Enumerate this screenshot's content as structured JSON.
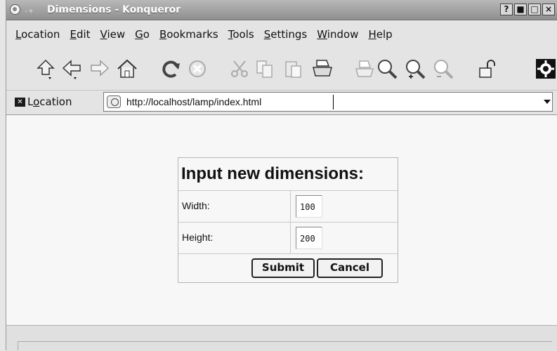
{
  "window": {
    "title": "Dimensions - Konqueror",
    "pin_glyph": "-+",
    "controls": [
      "?",
      "■",
      "□",
      "×"
    ]
  },
  "menubar": [
    {
      "mnemonic": "L",
      "rest": "ocation"
    },
    {
      "mnemonic": "E",
      "rest": "dit"
    },
    {
      "mnemonic": "V",
      "rest": "iew"
    },
    {
      "mnemonic": "G",
      "rest": "o"
    },
    {
      "mnemonic": "B",
      "rest": "ookmarks"
    },
    {
      "mnemonic": "T",
      "rest": "ools"
    },
    {
      "mnemonic": "S",
      "rest": "ettings"
    },
    {
      "mnemonic": "W",
      "rest": "indow"
    },
    {
      "mnemonic": "H",
      "rest": "elp"
    }
  ],
  "toolbar": [
    "up-icon",
    "back-icon",
    "forward-icon",
    "home-icon",
    "reload-icon",
    "stop-icon",
    "cut-icon",
    "copy-icon",
    "paste-icon",
    "print-icon",
    "print-frame-icon",
    "zoom-icon",
    "zoom-in-icon",
    "zoom-out-icon",
    "lock-icon",
    "throbber-icon"
  ],
  "location": {
    "label_mnemonic": "o",
    "label_before": "L",
    "label_after": "cation",
    "url": "http://localhost/lamp/index.html"
  },
  "form": {
    "title": "Input new dimensions:",
    "width_label": "Width:",
    "width_value": "100",
    "height_label": "Height:",
    "height_value": "200",
    "submit_label": "Submit",
    "cancel_label": "Cancel"
  }
}
